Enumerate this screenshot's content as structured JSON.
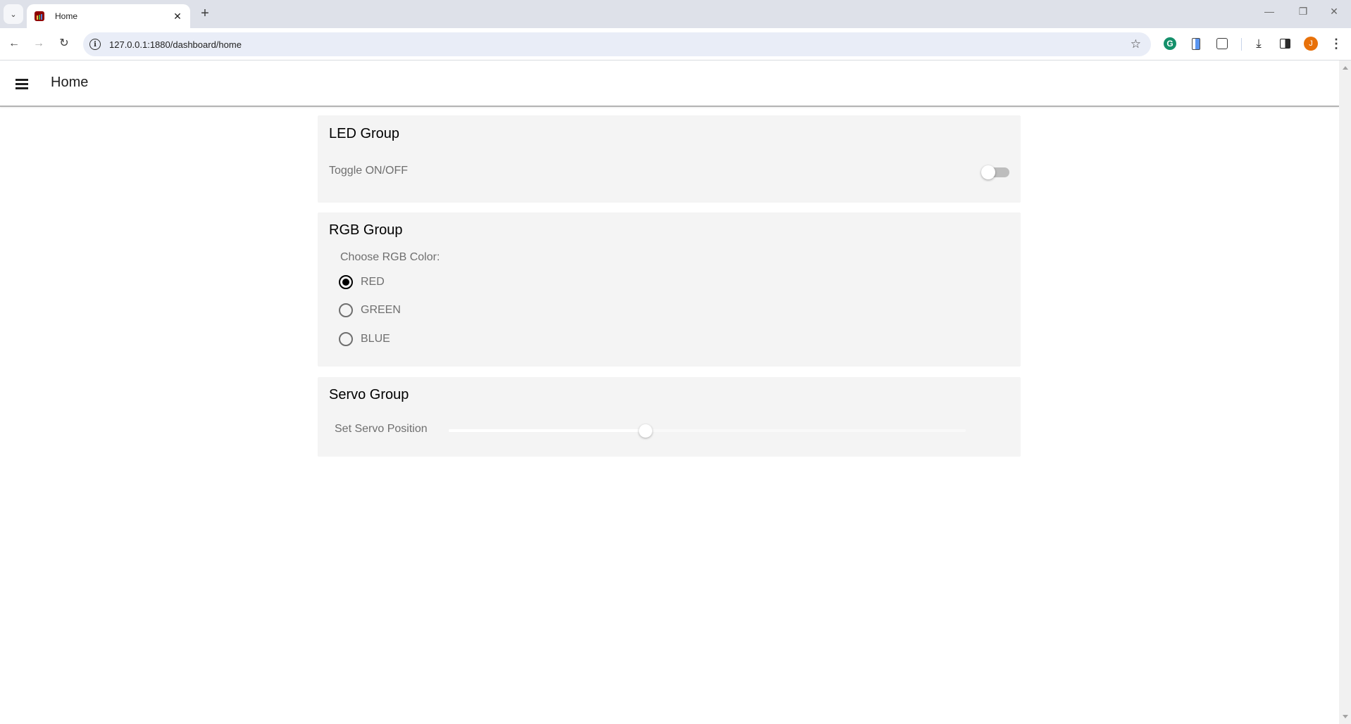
{
  "browser": {
    "tab": {
      "title": "Home",
      "favicon": "node-red-icon"
    },
    "address": {
      "url": "127.0.0.1:1880/dashboard/home"
    },
    "extensions": {
      "profile_initial": "J",
      "grammarly_letter": "G"
    },
    "icons": {
      "tab_search": "⌄",
      "close": "✕",
      "new_tab": "+",
      "back": "←",
      "forward": "→",
      "reload": "↻",
      "info": "i",
      "star": "☆",
      "download": "⤓",
      "kebab": "⋮",
      "minimize": "—",
      "restore": "❐",
      "window_close": "✕"
    }
  },
  "app": {
    "title": "Home",
    "groups": {
      "led": {
        "title": "LED Group",
        "toggle_label": "Toggle ON/OFF",
        "toggle_on": false
      },
      "rgb": {
        "title": "RGB Group",
        "caption": "Choose RGB Color:",
        "options": [
          {
            "label": "RED",
            "checked": true
          },
          {
            "label": "GREEN",
            "checked": false
          },
          {
            "label": "BLUE",
            "checked": false
          }
        ]
      },
      "servo": {
        "title": "Servo Group",
        "slider_label": "Set Servo Position",
        "slider_fraction": 0.38
      }
    }
  },
  "colors": {
    "card_bg": "#f4f4f4",
    "toggle_off_track": "#bdbdbd",
    "profile_avatar": "#e8710a",
    "grammarly": "#15906b"
  }
}
